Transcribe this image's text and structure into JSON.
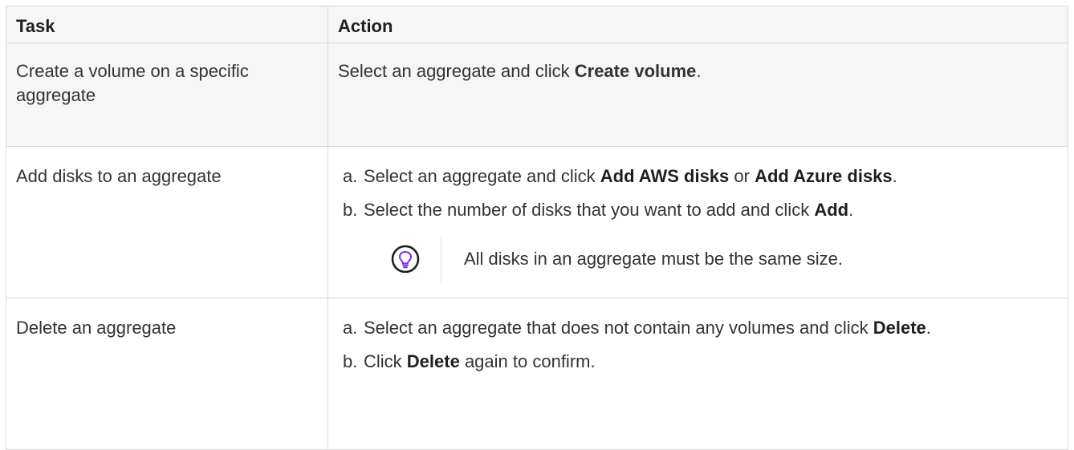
{
  "table": {
    "headers": {
      "task": "Task",
      "action": "Action"
    },
    "rows": [
      {
        "task": "Create a volume on a specific aggregate",
        "action": {
          "pre": "Select an aggregate and click ",
          "bold": "Create volume",
          "post": "."
        }
      },
      {
        "task": "Add disks to an aggregate",
        "steps": [
          {
            "marker": "a.",
            "pre": "Select an aggregate and click ",
            "bold1": "Add AWS disks",
            "mid": " or ",
            "bold2": "Add Azure disks",
            "post": "."
          },
          {
            "marker": "b.",
            "pre": "Select the number of disks that you want to add and click ",
            "bold": "Add",
            "post": "."
          }
        ],
        "tip": {
          "icon": "lightbulb-icon",
          "icon_color": "#7b2cf5",
          "text": "All disks in an aggregate must be the same size."
        }
      },
      {
        "task": "Delete an aggregate",
        "steps": [
          {
            "marker": "a.",
            "pre": "Select an aggregate that does not contain any volumes and click ",
            "bold": "Delete",
            "post": "."
          },
          {
            "marker": "b.",
            "pre": "Click ",
            "bold": "Delete",
            "post": " again to confirm."
          }
        ]
      }
    ]
  }
}
